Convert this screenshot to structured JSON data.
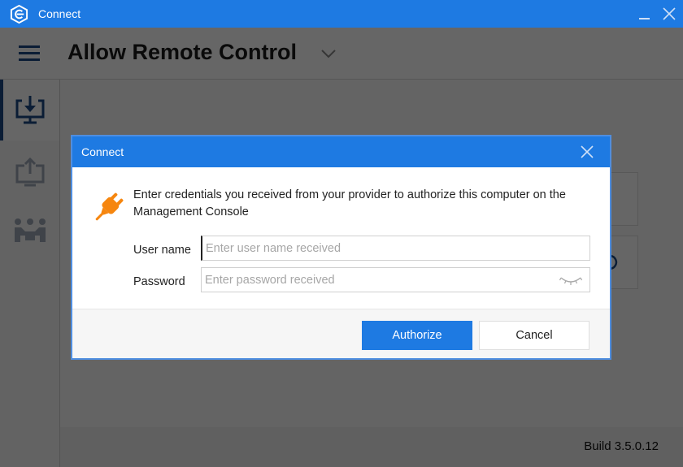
{
  "window": {
    "title": "Connect",
    "app_icon": "connect-logo-icon",
    "minimize_icon": "minimize-icon",
    "close_icon": "close-icon",
    "accent_color": "#1e7ae2"
  },
  "header": {
    "menu_icon": "hamburger-menu-icon",
    "title": "Allow Remote Control",
    "dropdown_icon": "chevron-down-icon"
  },
  "sidebar": {
    "items": [
      {
        "name": "allow-remote-control",
        "icon": "monitor-download-icon",
        "active": true
      },
      {
        "name": "remote-support",
        "icon": "monitor-upload-icon",
        "active": false
      },
      {
        "name": "meeting",
        "icon": "people-meeting-icon",
        "active": false
      }
    ]
  },
  "content": {
    "refresh_icon": "refresh-icon"
  },
  "footer": {
    "build": "Build 3.5.0.12"
  },
  "dialog": {
    "title": "Connect",
    "close_icon": "close-icon",
    "icon": "plug-icon",
    "message": "Enter credentials you received from your provider to authorize this computer on the Management Console",
    "username": {
      "label": "User name",
      "value": "",
      "placeholder": "Enter user name received"
    },
    "password": {
      "label": "Password",
      "value": "",
      "placeholder": "Enter password received",
      "toggle_icon": "eye-closed-icon"
    },
    "authorize_label": "Authorize",
    "cancel_label": "Cancel",
    "plug_color": "#f6860f"
  }
}
